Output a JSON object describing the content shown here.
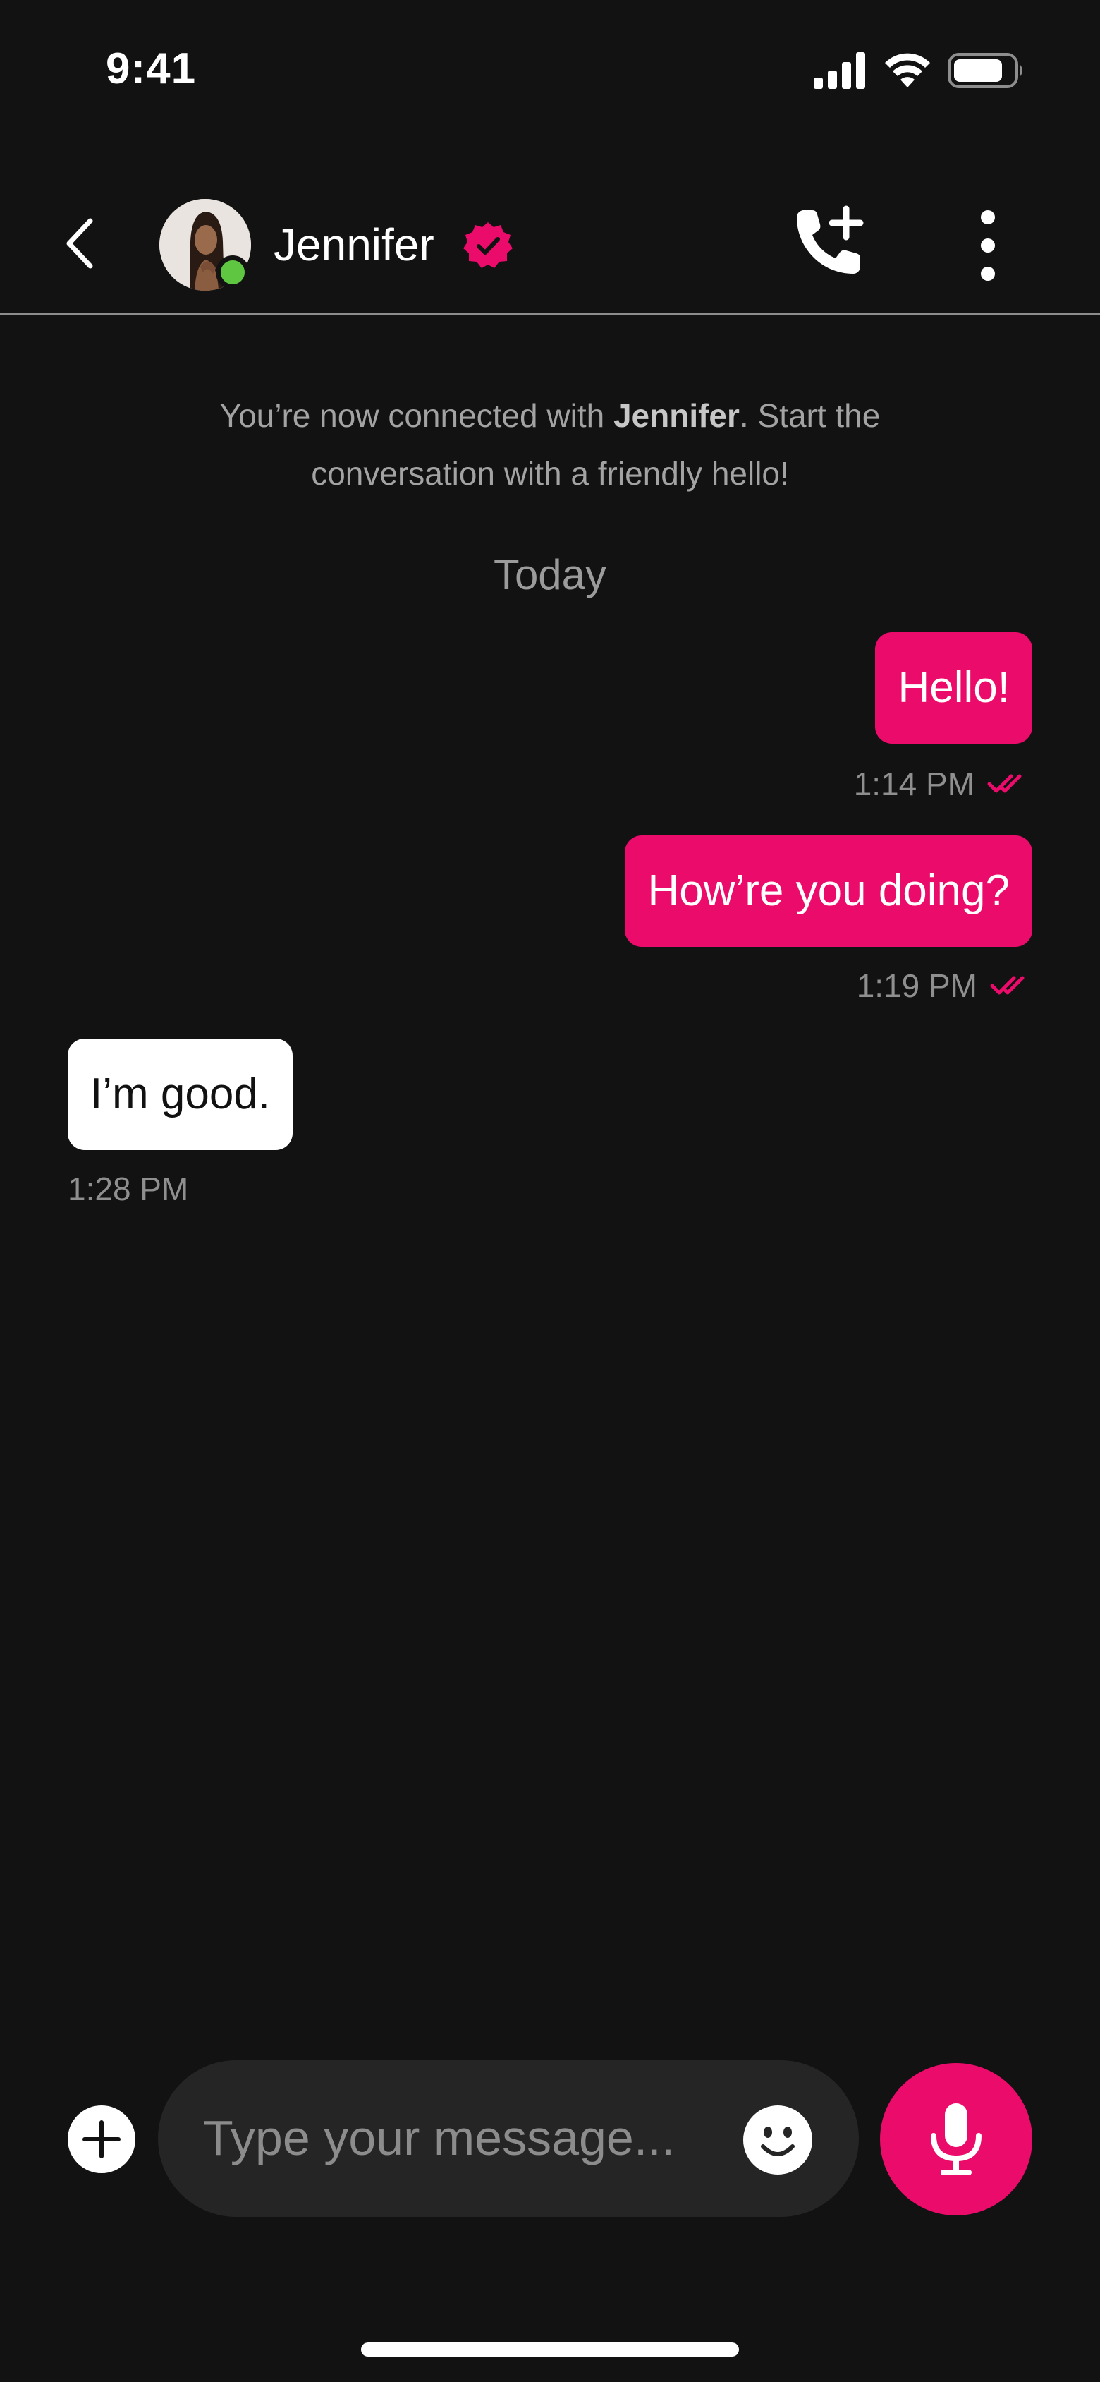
{
  "status_bar": {
    "time": "9:41"
  },
  "header": {
    "contact_name": "Jennifer",
    "verified": true,
    "online": true,
    "icons": [
      "chevron-left-icon",
      "avatar",
      "verified-badge-icon",
      "add-call-icon",
      "more-vertical-icon"
    ]
  },
  "intro": {
    "before": "You’re now connected with ",
    "name": "Jennifer",
    "after": ". Start the conversation with a friendly hello!"
  },
  "day_label": "Today",
  "messages": [
    {
      "direction": "outgoing",
      "text": "Hello!",
      "time": "1:14 PM",
      "read": true
    },
    {
      "direction": "outgoing",
      "text": "How’re you doing?",
      "time": "1:19 PM",
      "read": true
    },
    {
      "direction": "incoming",
      "text": "I’m good.",
      "time": "1:28 PM"
    }
  ],
  "composer": {
    "placeholder": "Type your message...",
    "icons": [
      "plus-circle-icon",
      "emoji-icon",
      "microphone-icon"
    ]
  },
  "colors": {
    "background": "#121212",
    "accent": "#ea0b6a",
    "online": "#5fc642",
    "input_bg": "#252525"
  }
}
